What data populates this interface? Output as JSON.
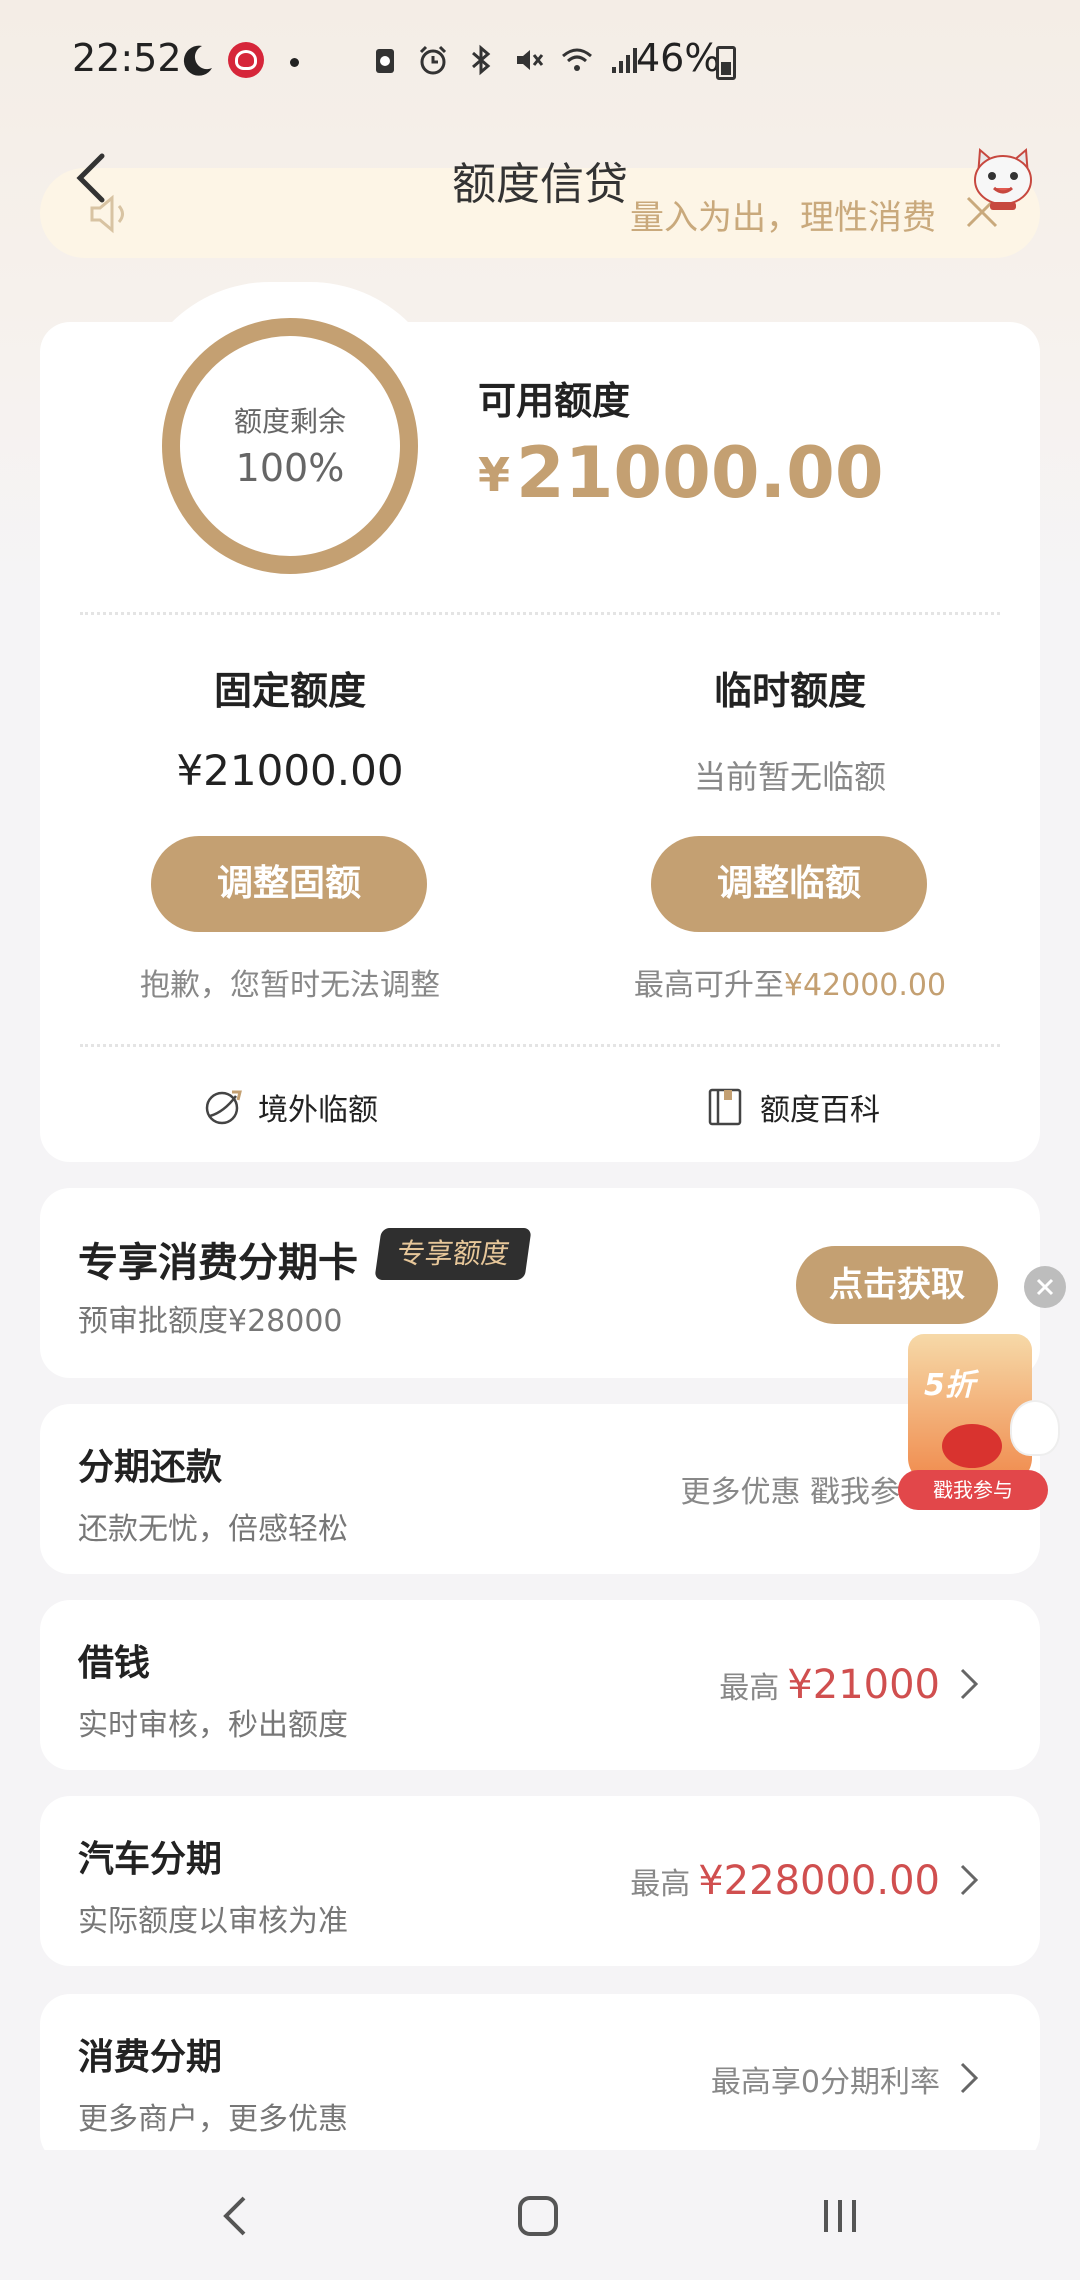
{
  "status_bar": {
    "time": "22:52",
    "battery": "46%"
  },
  "header": {
    "title": "额度信贷"
  },
  "notice": {
    "text": "量入为出，理性消费"
  },
  "credit": {
    "ring_label": "额度剩余",
    "ring_percent": "100%",
    "ring_fraction": 1.0,
    "available_label": "可用额度",
    "currency": "¥",
    "available_amount": "21000.00",
    "fixed": {
      "title": "固定额度",
      "value": "¥21000.00",
      "button": "调整固额",
      "note": "抱歉，您暂时无法调整"
    },
    "temporary": {
      "title": "临时额度",
      "value": "当前暂无临额",
      "button": "调整临额",
      "note_prefix": "最高可升至",
      "note_amount": "¥42000.00"
    },
    "links": {
      "overseas": "境外临额",
      "wiki": "额度百科"
    }
  },
  "exclusive": {
    "title": "专享消费分期卡",
    "badge": "专享额度",
    "subtitle": "预审批额度¥28000",
    "button": "点击获取"
  },
  "list": [
    {
      "title": "分期还款",
      "subtitle": "还款无忧，倍感轻松",
      "right_text": "更多优惠 戳我参"
    },
    {
      "title": "借钱",
      "subtitle": "实时审核，秒出额度",
      "prefix": "最高",
      "amount": "¥21000"
    },
    {
      "title": "汽车分期",
      "subtitle": "实际额度以审核为准",
      "prefix": "最高",
      "amount": "¥228000.00"
    },
    {
      "title": "消费分期",
      "subtitle": "更多商户，更多优惠",
      "right_text": "最高享0分期利率"
    }
  ],
  "promo": {
    "tag": "5折",
    "cta": "戳我参与"
  },
  "colors": {
    "gold": "#c4a072",
    "red_amount": "#d04f4f",
    "badge_bg": "#2f2f2f"
  }
}
